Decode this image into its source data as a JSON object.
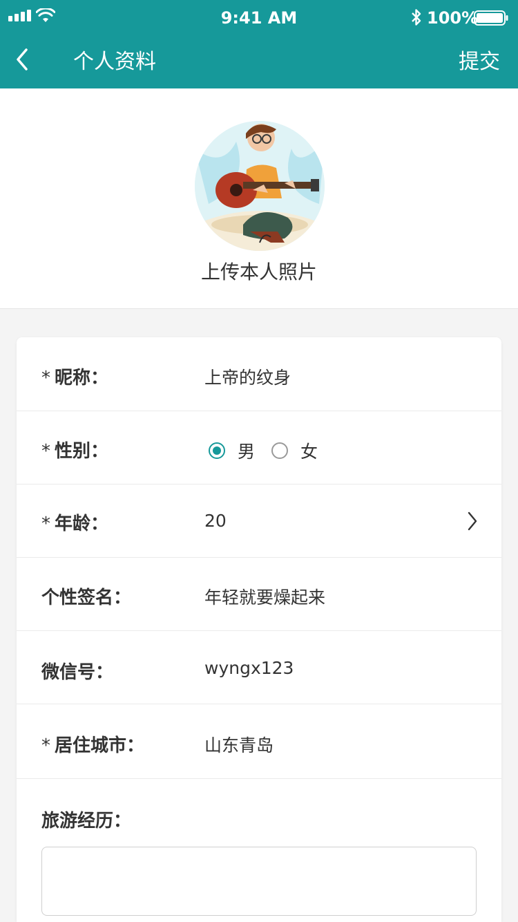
{
  "status_bar": {
    "time": "9:41 AM",
    "battery_percent": "100%",
    "icons": [
      "signal-icon",
      "wifi-icon",
      "bluetooth-icon",
      "battery-icon"
    ]
  },
  "nav": {
    "title": "个人资料",
    "submit_label": "提交",
    "back_icon": "back-chevron-icon"
  },
  "profile": {
    "upload_label": "上传本人照片"
  },
  "form": {
    "nickname": {
      "required": "*",
      "label": "昵称：",
      "value": "上帝的纹身"
    },
    "gender": {
      "required": "*",
      "label": "性别：",
      "options": [
        {
          "label": "男",
          "checked": true
        },
        {
          "label": "女",
          "checked": false
        }
      ]
    },
    "age": {
      "required": "*",
      "label": "年龄：",
      "value": "20"
    },
    "signature": {
      "label": "个性签名：",
      "value": "年轻就要燥起来"
    },
    "wechat": {
      "label": "微信号：",
      "value": "wyngx123"
    },
    "city": {
      "required": "*",
      "label": "居住城市：",
      "value": "山东青岛"
    },
    "travel": {
      "label": "旅游经历：",
      "value": ""
    }
  },
  "colors": {
    "brand": "#16999a",
    "text": "#333333",
    "divider": "#eaeaea",
    "page_bg": "#f4f4f4"
  }
}
